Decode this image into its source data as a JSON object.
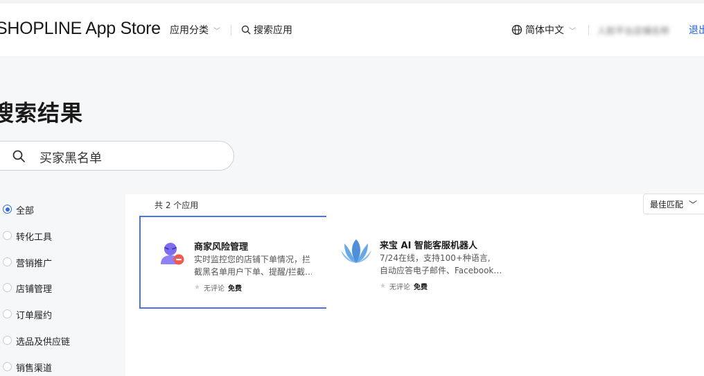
{
  "header": {
    "logo": "SHOPLINE App Store",
    "nav_categories": "应用分类",
    "nav_search": "搜索应用",
    "language": "简体中文",
    "user_name": "人脸平台店铺名称",
    "logout": "退出"
  },
  "page": {
    "title": "搜索结果",
    "search_query": "买家黑名单"
  },
  "sidebar": {
    "items": [
      {
        "label": "全部",
        "checked": true
      },
      {
        "label": "转化工具",
        "checked": false
      },
      {
        "label": "营销推广",
        "checked": false
      },
      {
        "label": "店铺管理",
        "checked": false
      },
      {
        "label": "订单履约",
        "checked": false
      },
      {
        "label": "选品及供应链",
        "checked": false
      },
      {
        "label": "销售渠道",
        "checked": false
      }
    ]
  },
  "results": {
    "count_label": "共 2 个应用",
    "sort_label": "最佳匹配",
    "apps": [
      {
        "title": "商家风险管理",
        "desc_line1": "实时监控您的店铺下单情况，拦",
        "desc_line2": "截黑名单用户下单、提醒/拦截…",
        "reviews": "无评论",
        "price": "免费",
        "icon": "risk-manager-icon"
      },
      {
        "title": "来宝 AI 智能客服机器人",
        "desc_line1": "7/24在线，支持100+种语言,",
        "desc_line2": "自动应答电子邮件、Facebook…",
        "reviews": "无评论",
        "price": "免费",
        "icon": "laibao-lotus-icon"
      }
    ]
  },
  "colors": {
    "accent": "#1d63e8",
    "selected_border": "#4a73e8",
    "background": "#f6f7f9"
  }
}
